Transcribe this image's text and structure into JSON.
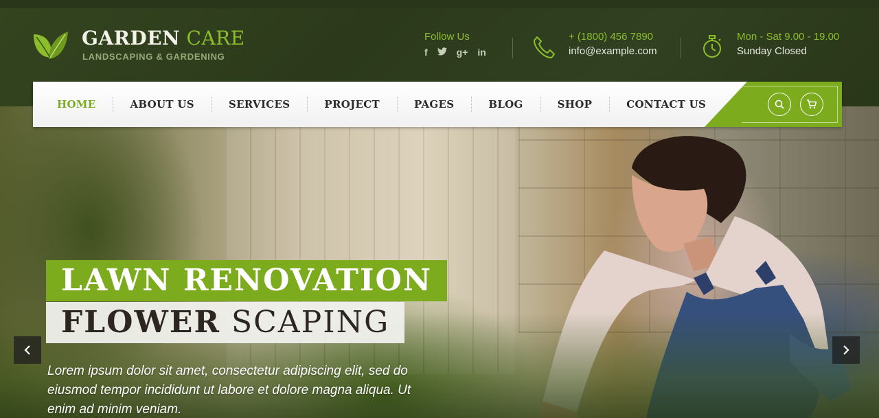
{
  "brand": {
    "name_part1": "GARDEN",
    "name_part2": "CARE",
    "tagline": "LANDSCAPING & GARDENING",
    "logo_icon": "leaf-icon"
  },
  "header": {
    "follow_label": "Follow Us",
    "social": [
      {
        "name": "facebook-icon",
        "glyph": "f"
      },
      {
        "name": "twitter-icon",
        "glyph": "🐦"
      },
      {
        "name": "google-plus-icon",
        "glyph": "g+"
      },
      {
        "name": "linkedin-icon",
        "glyph": "in"
      }
    ],
    "contact": {
      "phone": "+ (1800) 456 7890",
      "email": "info@example.com",
      "icon": "phone-icon"
    },
    "hours": {
      "line1": "Mon - Sat 9.00 - 19.00",
      "line2": "Sunday Closed",
      "icon": "stopwatch-icon"
    }
  },
  "nav": {
    "items": [
      {
        "label": "HOME",
        "active": true
      },
      {
        "label": "ABOUT US",
        "active": false
      },
      {
        "label": "SERVICES",
        "active": false
      },
      {
        "label": "PROJECT",
        "active": false
      },
      {
        "label": "PAGES",
        "active": false
      },
      {
        "label": "BLOG",
        "active": false
      },
      {
        "label": "SHOP",
        "active": false
      },
      {
        "label": "CONTACT US",
        "active": false
      }
    ],
    "search_icon": "search-icon",
    "cart_icon": "cart-icon"
  },
  "hero": {
    "title_line1": "LAWN RENOVATION",
    "title_line2_bold": "FLOWER",
    "title_line2_light": "SCAPING",
    "text": "Lorem ipsum dolor sit amet, consectetur adipiscing elit, sed do eiusmod tempor incididunt ut labore et dolore magna aliqua. Ut enim ad minim veniam.",
    "prev_icon": "chevron-left-icon",
    "next_icon": "chevron-right-icon"
  },
  "colors": {
    "accent": "#7cab1e",
    "header_bg": "#2e3b1f",
    "nav_text": "#2a2a2a"
  }
}
